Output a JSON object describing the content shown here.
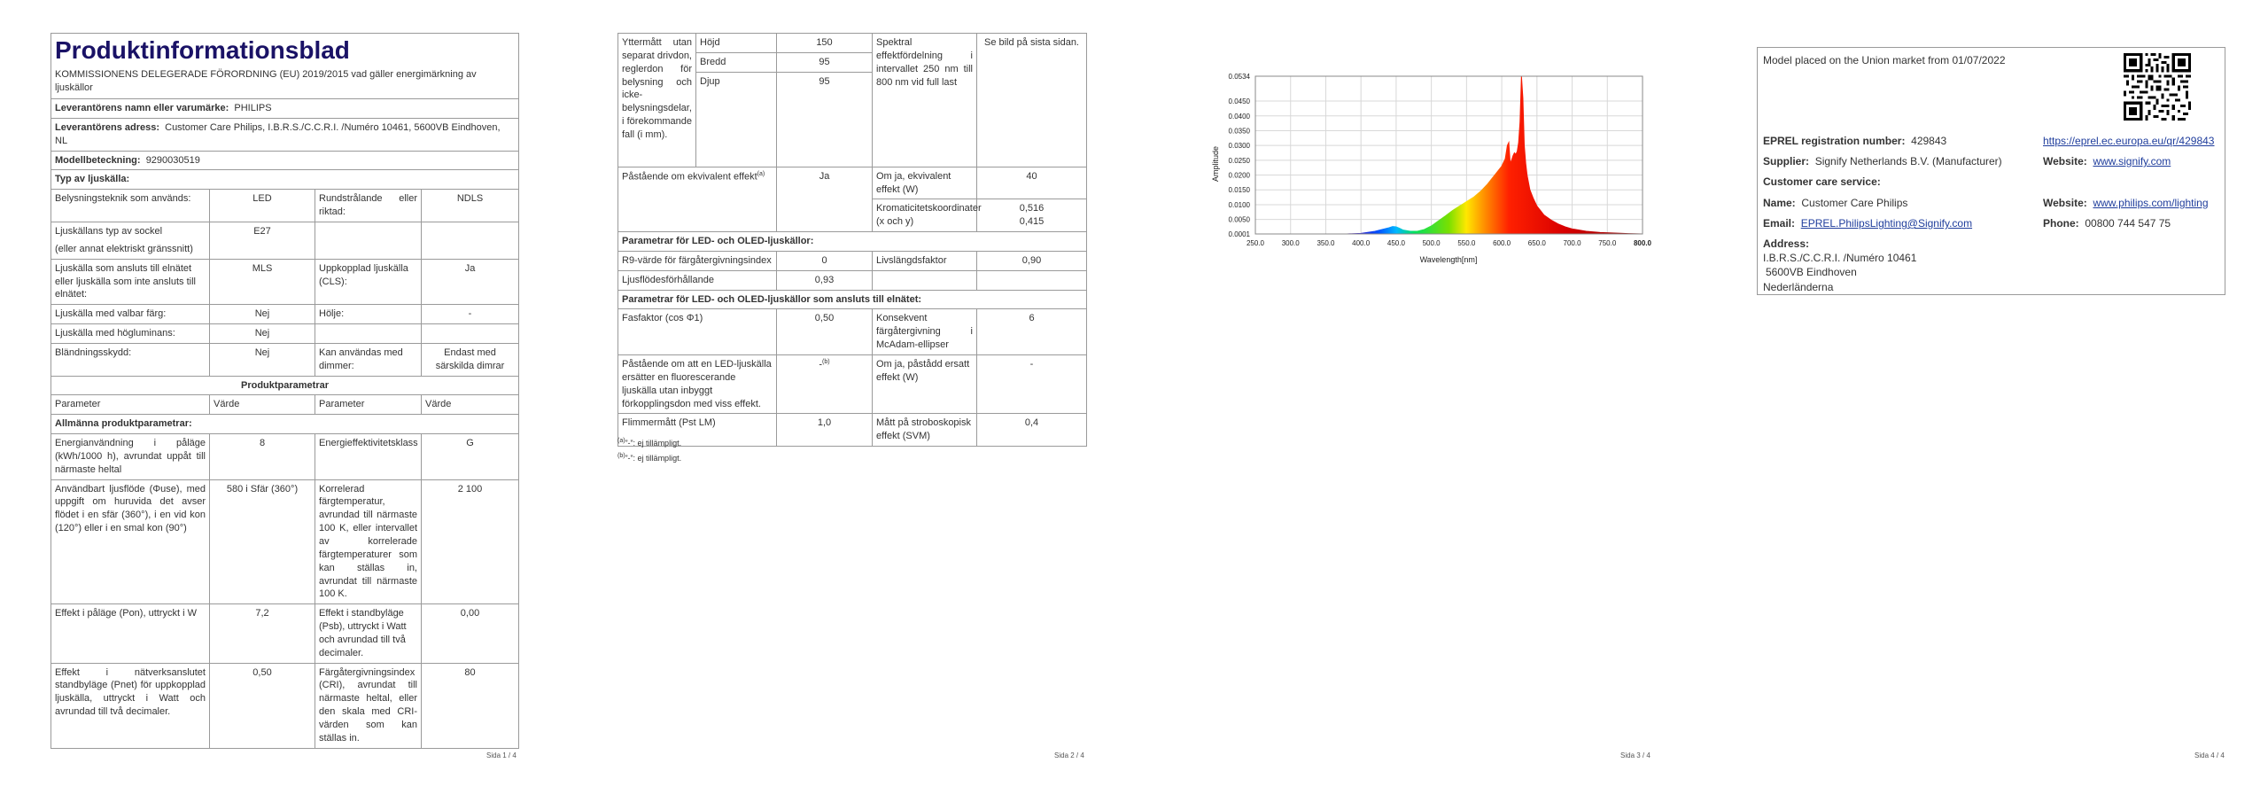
{
  "page1": {
    "title": "Produktinformationsblad",
    "regulation": "KOMMISSIONENS DELEGERADE FÖRORDNING (EU) 2019/2015 vad gäller energimärkning av ljuskällor",
    "supplier_label": "Leverantörens namn eller varumärke:",
    "supplier_value": "PHILIPS",
    "address_label": "Leverantörens adress:",
    "address_value": "Customer Care Philips, I.B.R.S./C.C.R.I. /Numéro 10461, 5600VB Eindhoven, NL",
    "model_label": "Modellbeteckning:",
    "model_value": "9290030519",
    "type_header": "Typ av ljuskälla:",
    "rows_a": [
      {
        "p1": "Belysningsteknik som används:",
        "v1": "LED",
        "p2": "Rundstrålande eller riktad:",
        "v2": "NDLS"
      },
      {
        "p1": "Ljuskällans typ av sockel",
        "p1b": "(eller annat elektriskt gränssnitt)",
        "v1": "E27",
        "p2": "",
        "v2": ""
      },
      {
        "p1": "Ljuskälla som ansluts till elnätet eller ljuskälla som inte ansluts till elnätet:",
        "v1": "MLS",
        "p2": "Uppkopplad ljuskälla (CLS):",
        "v2": "Ja"
      },
      {
        "p1": "Ljuskälla med valbar färg:",
        "v1": "Nej",
        "p2": "Hölje:",
        "v2": "-"
      },
      {
        "p1": "Ljuskälla med högluminans:",
        "v1": "Nej",
        "p2": "",
        "v2": ""
      },
      {
        "p1": "Bländningsskydd:",
        "v1": "Nej",
        "p2": "Kan användas med dimmer:",
        "v2": "Endast med särskilda dimrar"
      }
    ],
    "product_params_header": "Produktparametrar",
    "col_headers": [
      "Parameter",
      "Värde",
      "Parameter",
      "Värde"
    ],
    "general_header": "Allmänna produktparametrar:",
    "rows_b": [
      {
        "p1": "Energianvändning i påläge (kWh/1000 h), avrundat uppåt till närmaste heltal",
        "v1": "8",
        "p2": "Energieffektivitetsklass",
        "v2": "G"
      },
      {
        "p1": "Användbart ljusflöde (Φuse), med uppgift om huruvida det avser flödet i en sfär (360°), i en vid kon (120°) eller i en smal kon (90°)",
        "v1": "580 i Sfär (360°)",
        "p2": "Korrelerad färgtemperatur, avrundad till närmaste 100 K, eller intervallet av korrelerade färgtemperaturer som kan ställas in, avrundat till närmaste 100 K.",
        "v2": "2 100"
      },
      {
        "p1": "Effekt i påläge (Pon), uttryckt i W",
        "v1": "7,2",
        "p2": "Effekt i standbyläge (Psb), uttryckt i Watt och avrundad till två decimaler.",
        "v2": "0,00"
      },
      {
        "p1": "Effekt i nätverksanslutet standbyläge (Pnet) för uppkopplad ljuskälla, uttryckt i Watt och avrundad till två decimaler.",
        "v1": "0,50",
        "p2": "Färgåtergivningsindex (CRI), avrundat till närmaste heltal, eller den skala med CRI-värden som kan ställas in.",
        "v2": "80"
      }
    ],
    "footer": "Sida 1 / 4"
  },
  "page2": {
    "dims_label": "Yttermått utan separat drivdon, reglerdon för belysning och icke-belysningsdelar, i förekommande fall (i mm).",
    "dims": [
      {
        "k": "Höjd",
        "v": "150"
      },
      {
        "k": "Bredd",
        "v": "95"
      },
      {
        "k": "Djup",
        "v": "95"
      }
    ],
    "spectral_label": "Spektral effektfördelning i intervallet 250 nm till 800 nm vid full last",
    "spectral_value": "Se bild på sista sidan.",
    "equiv_label": "Påstående om ekvivalent effekt",
    "equiv_sup": "(a)",
    "equiv_value": "Ja",
    "equiv_w_label": "Om ja, ekvivalent effekt (W)",
    "equiv_w_value": "40",
    "chroma_label": "Kromaticitetskoordinater (x och y)",
    "chroma_x": "0,516",
    "chroma_y": "0,415",
    "led_header": "Parametrar för LED- och OLED-ljuskällor:",
    "r9_label": "R9-värde för färgåtergivningsindex",
    "r9_value": "0",
    "life_label": "Livslängdsfaktor",
    "life_value": "0,90",
    "flux_label": "Ljusflödesförhållande",
    "flux_value": "0,93",
    "mains_header": "Parametrar för LED- och OLED-ljuskällor som ansluts till elnätet:",
    "pf_label": "Fasfaktor (cos Φ1)",
    "pf_value": "0,50",
    "consist_label": "Konsekvent färgåtergivning i McAdam-ellipser",
    "consist_value": "6",
    "fluor_label": "Påstående om att en LED-ljuskälla ersätter en fluorescerande ljuskälla utan inbyggt förkopplingsdon med viss effekt.",
    "fluor_value": "-",
    "fluor_sup": "(b)",
    "fluor_w_label": "Om ja, påstådd ersatt effekt (W)",
    "fluor_w_value": "-",
    "flicker_label": "Flimmermått (Pst LM)",
    "flicker_value": "1,0",
    "strobo_label": "Mått på stroboskopisk effekt (SVM)",
    "strobo_value": "0,4",
    "fn_a_mark": "(a)",
    "fn_a": "”-”: ej tillämpligt.",
    "fn_b_mark": "(b)",
    "fn_b": "”-”: ej tillämpligt.",
    "footer": "Sida 2 / 4"
  },
  "page3": {
    "footer": "Sida 3 / 4"
  },
  "chart_data": {
    "type": "line",
    "title": "",
    "xlabel": "Wavelength[nm]",
    "ylabel": "Amplitude",
    "xlim": [
      250,
      800
    ],
    "ylim": [
      0.0001,
      0.0534
    ],
    "grid": true,
    "legend": "none",
    "x_ticks": [
      "250.0",
      "300.0",
      "350.0",
      "400.0",
      "450.0",
      "500.0",
      "550.0",
      "600.0",
      "650.0",
      "700.0",
      "750.0",
      "800.0"
    ],
    "y_ticks": [
      "0.0001",
      "0.0050",
      "0.0100",
      "0.0150",
      "0.0200",
      "0.0250",
      "0.0300",
      "0.0350",
      "0.0400",
      "0.0450",
      "0.0534"
    ],
    "series": [
      {
        "x": [
          380,
          400,
          420,
          430,
          440,
          445,
          450,
          455,
          460,
          470,
          480,
          490,
          500,
          510,
          520,
          530,
          540,
          550,
          560,
          570,
          580,
          585,
          590,
          595,
          600,
          605,
          608,
          610,
          612,
          614,
          616,
          618,
          620,
          622,
          624,
          626,
          628,
          630,
          632,
          634,
          636,
          640,
          645,
          650,
          655,
          660,
          670,
          680,
          690,
          700,
          720,
          740,
          760,
          780,
          800
        ],
        "values": [
          0.0001,
          0.0003,
          0.001,
          0.0016,
          0.0022,
          0.0026,
          0.0025,
          0.002,
          0.0014,
          0.001,
          0.001,
          0.0016,
          0.0028,
          0.0045,
          0.0062,
          0.008,
          0.0095,
          0.011,
          0.0125,
          0.0145,
          0.017,
          0.0185,
          0.02,
          0.0215,
          0.023,
          0.0255,
          0.03,
          0.031,
          0.024,
          0.025,
          0.0265,
          0.0275,
          0.027,
          0.028,
          0.031,
          0.038,
          0.0534,
          0.046,
          0.03,
          0.024,
          0.02,
          0.015,
          0.012,
          0.0095,
          0.008,
          0.0065,
          0.0048,
          0.0035,
          0.0025,
          0.0018,
          0.001,
          0.0006,
          0.0004,
          0.0002,
          0.0001
        ]
      }
    ]
  },
  "page4": {
    "placed": "Model placed on the Union market from 01/07/2022",
    "eprel_label": "EPREL registration number:",
    "eprel_value": "429843",
    "eprel_link": "https://eprel.ec.europa.eu/qr/429843",
    "supplier_label": "Supplier:",
    "supplier_value": "Signify Netherlands B.V. (Manufacturer)",
    "website_label": "Website:",
    "website_value": "www.signify.com",
    "care_header": "Customer care service:",
    "name_label": "Name:",
    "name_value": "Customer Care Philips",
    "website2_label": "Website:",
    "website2_value": "www.philips.com/lighting",
    "email_label": "Email:",
    "email_value": "EPREL.PhilipsLighting@Signify.com",
    "phone_label": "Phone:",
    "phone_value": "00800 744 547 75",
    "address_label": "Address:",
    "address_lines": [
      "I.B.R.S./C.C.R.I. /Numéro 10461",
      "5600VB Eindhoven",
      "Nederländerna"
    ],
    "qr_icon": "qr-code-icon",
    "footer": "Sida 4 / 4"
  }
}
